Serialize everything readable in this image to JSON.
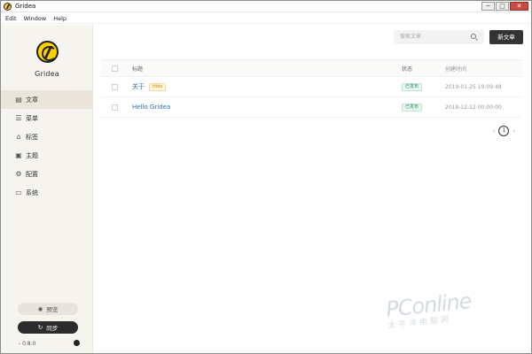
{
  "window": {
    "title": "Gridea",
    "controls": [
      "─",
      "□",
      "✕"
    ]
  },
  "menu": [
    "Edit",
    "Window",
    "Help"
  ],
  "sidebar": {
    "brand": "Gridea",
    "items": [
      {
        "label": "文章",
        "icon": "document-icon"
      },
      {
        "label": "菜单",
        "icon": "menu-icon"
      },
      {
        "label": "标签",
        "icon": "tag-icon"
      },
      {
        "label": "主题",
        "icon": "image-icon"
      },
      {
        "label": "配置",
        "icon": "gear-icon"
      },
      {
        "label": "系统",
        "icon": "monitor-icon"
      }
    ],
    "preview_label": "预览",
    "sync_label": "同步",
    "version": "- 0.8.0"
  },
  "toolbar": {
    "search_placeholder": "搜索文章",
    "new_post_label": "新文章"
  },
  "table": {
    "headers": {
      "title": "标题",
      "status": "状态",
      "created": "创建时间"
    },
    "rows": [
      {
        "title": "关于",
        "tag": "Hide",
        "status": "已发布",
        "date": "2019-01-25 19:09:48"
      },
      {
        "title": "Hello Gridea",
        "tag": "",
        "status": "已发布",
        "date": "2018-12-12 00:00:00"
      }
    ]
  },
  "pagination": {
    "current_page": "1",
    "prev": "‹",
    "next": "›"
  },
  "watermark": {
    "text": "PConline",
    "subtext": "太平洋电脑网"
  },
  "colors": {
    "accent": "#ffd000",
    "dark": "#333333",
    "link": "#2b72b4",
    "published": "#2e8b57"
  }
}
